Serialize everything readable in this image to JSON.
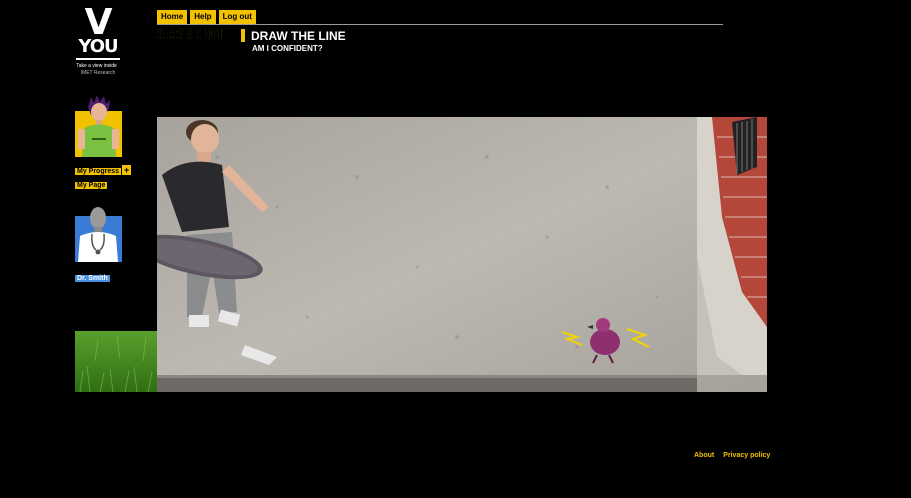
{
  "logo": {
    "mark": "V",
    "word": "YOU",
    "tagline": "Take a view inside",
    "sub": "IMET Research"
  },
  "nav": {
    "home": "Home",
    "help": "Help",
    "logout": "Log out"
  },
  "session": {
    "label": "SESSION",
    "number": "1",
    "title": "DRAW THE LINE",
    "subtitle": "AM I CONFIDENT?"
  },
  "sidebar": {
    "progress": "My Progress",
    "progress_plus": "+",
    "page": "My Page",
    "doctor": "Dr. Smith"
  },
  "footer": {
    "about": "About",
    "privacy": "Privacy policy"
  },
  "colors": {
    "accent": "#f2c200",
    "doctor_badge": "#4a90e2",
    "background": "#000000"
  }
}
